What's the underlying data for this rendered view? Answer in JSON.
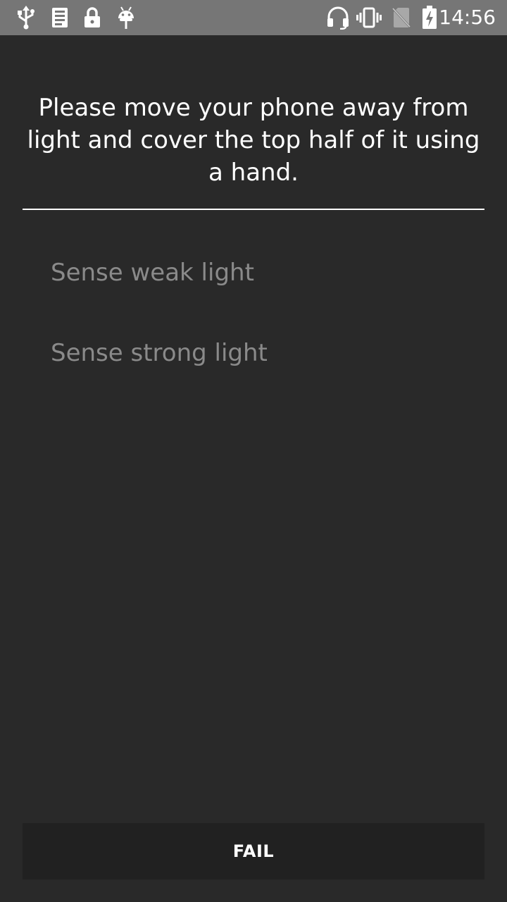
{
  "status_bar": {
    "time": "14:56",
    "icons_left": [
      "usb-icon",
      "logcat-icon",
      "lock-icon",
      "android-debug-icon"
    ],
    "icons_right": [
      "headset-icon",
      "vibrate-icon",
      "no-sim-icon",
      "battery-charging-icon"
    ]
  },
  "main": {
    "instruction": "Please move your phone away from light and cover the top half of it using a hand.",
    "items": [
      {
        "label": "Sense weak light"
      },
      {
        "label": "Sense strong light"
      }
    ]
  },
  "footer": {
    "fail_label": "FAIL"
  },
  "colors": {
    "background": "#292929",
    "status_bar": "#767676",
    "instruction_text": "#ffffff",
    "item_text_disabled": "#8a8a8a",
    "button_background": "#212121"
  }
}
